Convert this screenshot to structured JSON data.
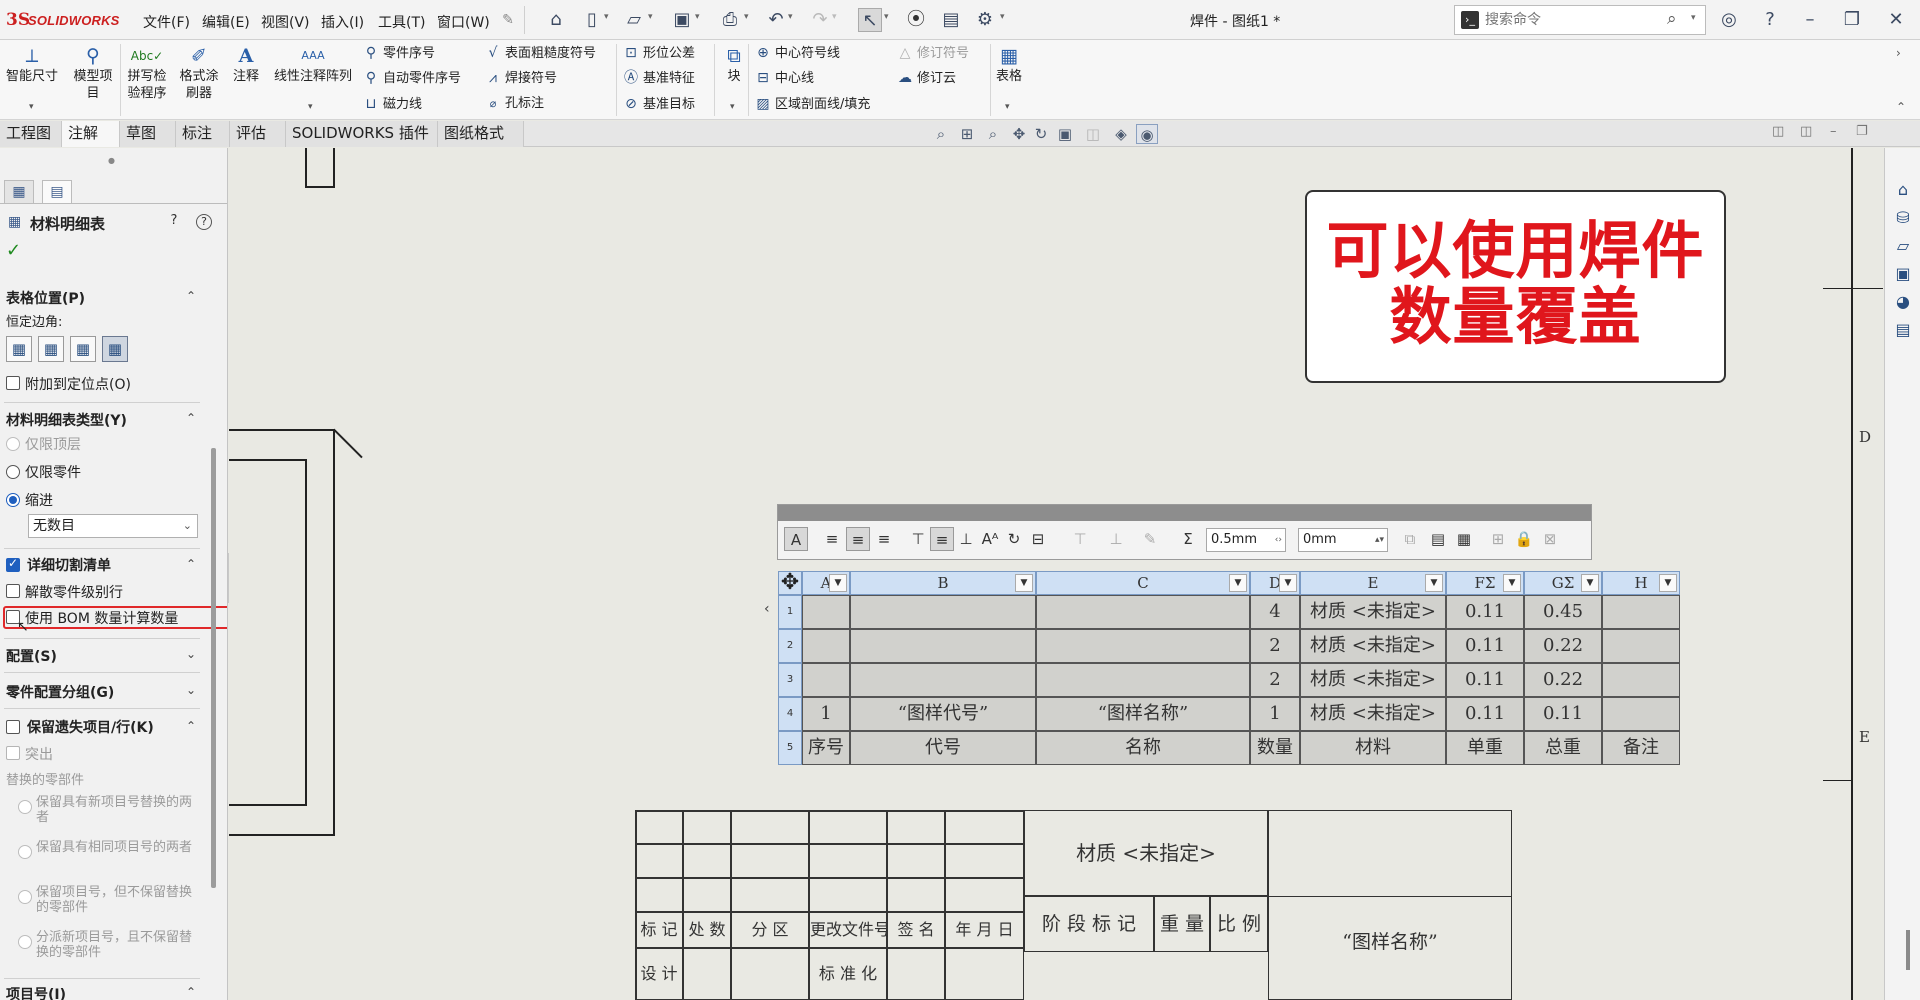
{
  "app": {
    "logo_ds": "3S",
    "logo_text": "SOLIDWORKS",
    "document_title": "焊件 - 图纸1 *"
  },
  "menu": [
    "文件(F)",
    "编辑(E)",
    "视图(V)",
    "插入(I)",
    "工具(T)",
    "窗口(W)"
  ],
  "search": {
    "placeholder": "搜索命令"
  },
  "ribbon": {
    "smart_dim": "智能尺寸",
    "model_items": [
      "模型项",
      "目"
    ],
    "spell_check": [
      "拼写检",
      "验程序"
    ],
    "format_painter": [
      "格式涂",
      "刷器"
    ],
    "note": "注释",
    "linear_note_pattern": "线性注释阵列",
    "balloon": "零件序号",
    "auto_balloon": "自动零件序号",
    "magnetic_line": "磁力线",
    "surface_finish": "表面粗糙度符号",
    "weld_symbol": "焊接符号",
    "hole_callout": "孔标注",
    "gtol": "形位公差",
    "datum_feature": "基准特征",
    "datum_target": "基准目标",
    "block": "块",
    "center_mark": "中心符号线",
    "centerline": "中心线",
    "area_hatch": "区域剖面线/填充",
    "revision_symbol": "修订符号",
    "revision_cloud": "修订云",
    "tables": "表格"
  },
  "tabs": [
    "工程图",
    "注解",
    "草图",
    "标注",
    "评估",
    "SOLIDWORKS 插件",
    "图纸格式"
  ],
  "active_tab": "注解",
  "panel": {
    "title": "材料明细表",
    "table_position": {
      "header": "表格位置(P)",
      "anchor_label": "恒定边角:",
      "attach_label": "附加到定位点(O)"
    },
    "bom_type": {
      "header": "材料明细表类型(Y)",
      "top_level": "仅限顶层",
      "parts_only": "仅限零件",
      "indented": "缩进",
      "numbering": "无数目"
    },
    "cut_list": {
      "header": "详细切割清单",
      "dissolve": "解散零件级别行",
      "use_bom_qty": "使用 BOM 数量计算数量"
    },
    "configurations": "配置(S)",
    "part_config_grouping": "零件配置分组(G)",
    "keep_missing": {
      "header": "保留遗失项目/行(K)",
      "strikeout": "突出",
      "replaced_components": "替换的零部件",
      "opt1": "保留具有新项目号替换的两者",
      "opt2": "保留具有相同项目号的两者",
      "opt3": "保留项目号，但不保留替换的零部件",
      "opt4": "分派新项目号，且不保留替换的零部件"
    },
    "item_numbers": "项目号(I)"
  },
  "annotation": {
    "line1": "可以使用焊件",
    "line2": "数量覆盖"
  },
  "zones": {
    "d": "D",
    "e": "E"
  },
  "format_toolbar": {
    "thickness": "0.5mm",
    "spacing": "0mm"
  },
  "bom": {
    "columns": [
      "A",
      "B",
      "C",
      "D",
      "E",
      "F",
      "G",
      "H"
    ],
    "row_numbers": [
      "1",
      "2",
      "3",
      "4",
      "5"
    ],
    "rows": [
      [
        "",
        "",
        "",
        "4",
        "材质 <未指定>",
        "0.11",
        "0.45",
        ""
      ],
      [
        "",
        "",
        "",
        "2",
        "材质 <未指定>",
        "0.11",
        "0.22",
        ""
      ],
      [
        "",
        "",
        "",
        "2",
        "材质 <未指定>",
        "0.11",
        "0.22",
        ""
      ],
      [
        "1",
        "“图样代号”",
        "“图样名称”",
        "1",
        "材质 <未指定>",
        "0.11",
        "0.11",
        ""
      ],
      [
        "序号",
        "代号",
        "名称",
        "数量",
        "材料",
        "单重",
        "总重",
        "备注"
      ]
    ]
  },
  "title_block": {
    "material": "材质 <未指定>",
    "revision_headers": [
      "标 记",
      "处 数",
      "分 区",
      "更改文件号",
      "签 名",
      "年 月 日"
    ],
    "stage": "阶 段 标 记",
    "weight": "重 量",
    "scale": "比 例",
    "drawing_name": "“图样名称”",
    "design": "设 计",
    "standardization": "标 准 化"
  }
}
